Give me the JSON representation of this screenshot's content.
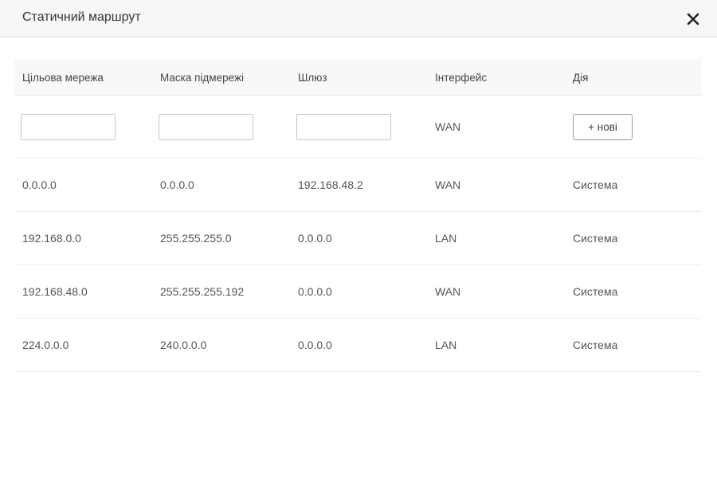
{
  "dialog": {
    "title": "Статичний маршрут",
    "close_icon": "close-icon"
  },
  "table": {
    "headers": [
      "Цільова мережа",
      "Маска підмережі",
      "Шлюз",
      "Інтерфейс",
      "Дія"
    ],
    "input_row": {
      "target_value": "",
      "mask_value": "",
      "gateway_value": "",
      "interface": "WAN",
      "add_label": "+ нові"
    },
    "rows": [
      {
        "target": "0.0.0.0",
        "mask": "0.0.0.0",
        "gateway": "192.168.48.2",
        "interface": "WAN",
        "action": "Система"
      },
      {
        "target": "192.168.0.0",
        "mask": "255.255.255.0",
        "gateway": "0.0.0.0",
        "interface": "LAN",
        "action": "Система"
      },
      {
        "target": "192.168.48.0",
        "mask": "255.255.255.192",
        "gateway": "0.0.0.0",
        "interface": "WAN",
        "action": "Система"
      },
      {
        "target": "224.0.0.0",
        "mask": "240.0.0.0",
        "gateway": "0.0.0.0",
        "interface": "LAN",
        "action": "Система"
      }
    ]
  }
}
